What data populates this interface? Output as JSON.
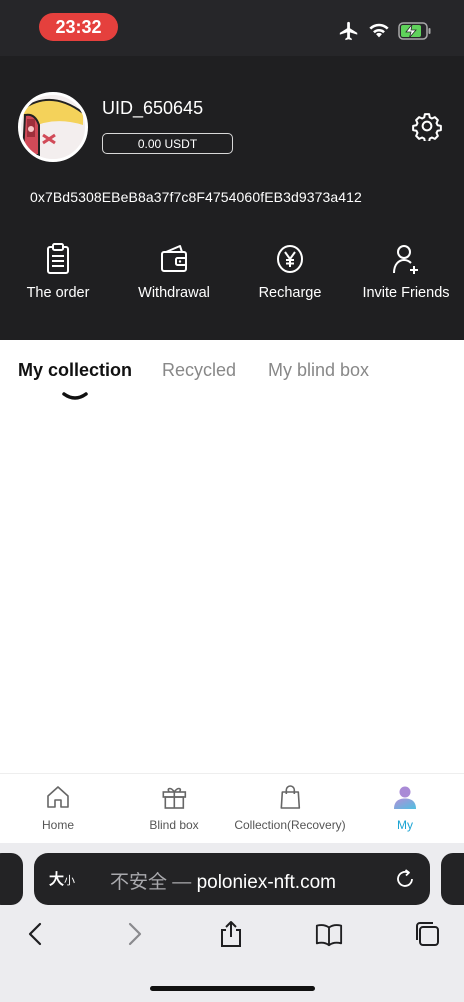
{
  "status_bar": {
    "time": "23:32",
    "icons": [
      "airplane-icon",
      "wifi-icon",
      "battery-charging-icon"
    ],
    "time_color": "#e5403d"
  },
  "profile": {
    "uid": "UID_650645",
    "balance": "0.00 USDT",
    "address": "0x7Bd5308EBeB8a37f7c8F4754060fEB3d9373a412"
  },
  "actions": [
    {
      "label": "The order",
      "icon": "clipboard-icon"
    },
    {
      "label": "Withdrawal",
      "icon": "wallet-icon"
    },
    {
      "label": "Recharge",
      "icon": "yen-coin-icon"
    },
    {
      "label": "Invite Friends",
      "icon": "add-user-icon"
    }
  ],
  "tabs": [
    {
      "label": "My collection",
      "active": true
    },
    {
      "label": "Recycled",
      "active": false
    },
    {
      "label": "My blind box",
      "active": false
    }
  ],
  "bottom_nav": [
    {
      "label": "Home",
      "icon": "home-icon"
    },
    {
      "label": "Blind box",
      "icon": "gift-icon"
    },
    {
      "label": "Collection(Recovery)",
      "icon": "shopping-bag-icon"
    },
    {
      "label": "My",
      "icon": "user-icon",
      "active": true
    }
  ],
  "browser": {
    "reader_label_big": "大",
    "reader_label_small": "小",
    "insecure_label": "不安全 — ",
    "domain": "poloniex-nft.com",
    "toolbar": [
      "back-icon",
      "forward-icon",
      "share-icon",
      "bookmarks-icon",
      "tabs-icon"
    ]
  },
  "colors": {
    "header_bg": "#1f1f21",
    "accent": "#1aa4d4"
  }
}
